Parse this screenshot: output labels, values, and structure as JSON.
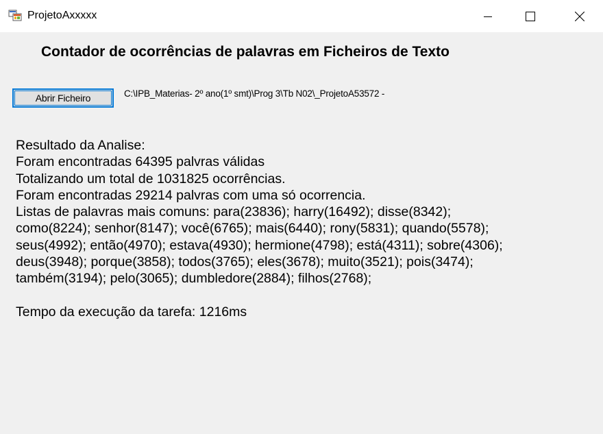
{
  "window": {
    "title": "ProjetoAxxxxx",
    "controls": {
      "minimize": "minimize",
      "maximize": "maximize",
      "close": "close"
    }
  },
  "main": {
    "heading": "Contador de ocorrências de palavras em Ficheiros de Texto",
    "open_button_label": "Abrir Ficheiro",
    "file_path": "C:\\IPB_Materias- 2º ano(1º smt)\\Prog 3\\Tb N02\\_ProjetoA53572 -",
    "results": {
      "header": "Resultado da Analise:",
      "valid_words": "Foram encontradas 64395 palvras válidas",
      "total_occurrences": "Totalizando um total de 1031825 ocorrências.",
      "single_occurrence": "Foram encontradas 29214 palvras com uma só ocorrencia.",
      "common_words_lines": [
        "Listas de palavras mais comuns: para(23836); harry(16492); disse(8342);",
        "como(8224); senhor(8147); você(6765); mais(6440); rony(5831); quando(5578);",
        "seus(4992); então(4970); estava(4930); hermione(4798); está(4311); sobre(4306);",
        "deus(3948); porque(3858); todos(3765); eles(3678); muito(3521); pois(3474);",
        "também(3194); pelo(3065); dumbledore(2884); filhos(2768);"
      ],
      "execution_time": "Tempo da execução da tarefa: 1216ms"
    }
  },
  "colors": {
    "window_bg": "#f0f0f0",
    "titlebar_bg": "#ffffff",
    "button_border": "#0078d7",
    "button_bg": "#e1e1e1"
  }
}
